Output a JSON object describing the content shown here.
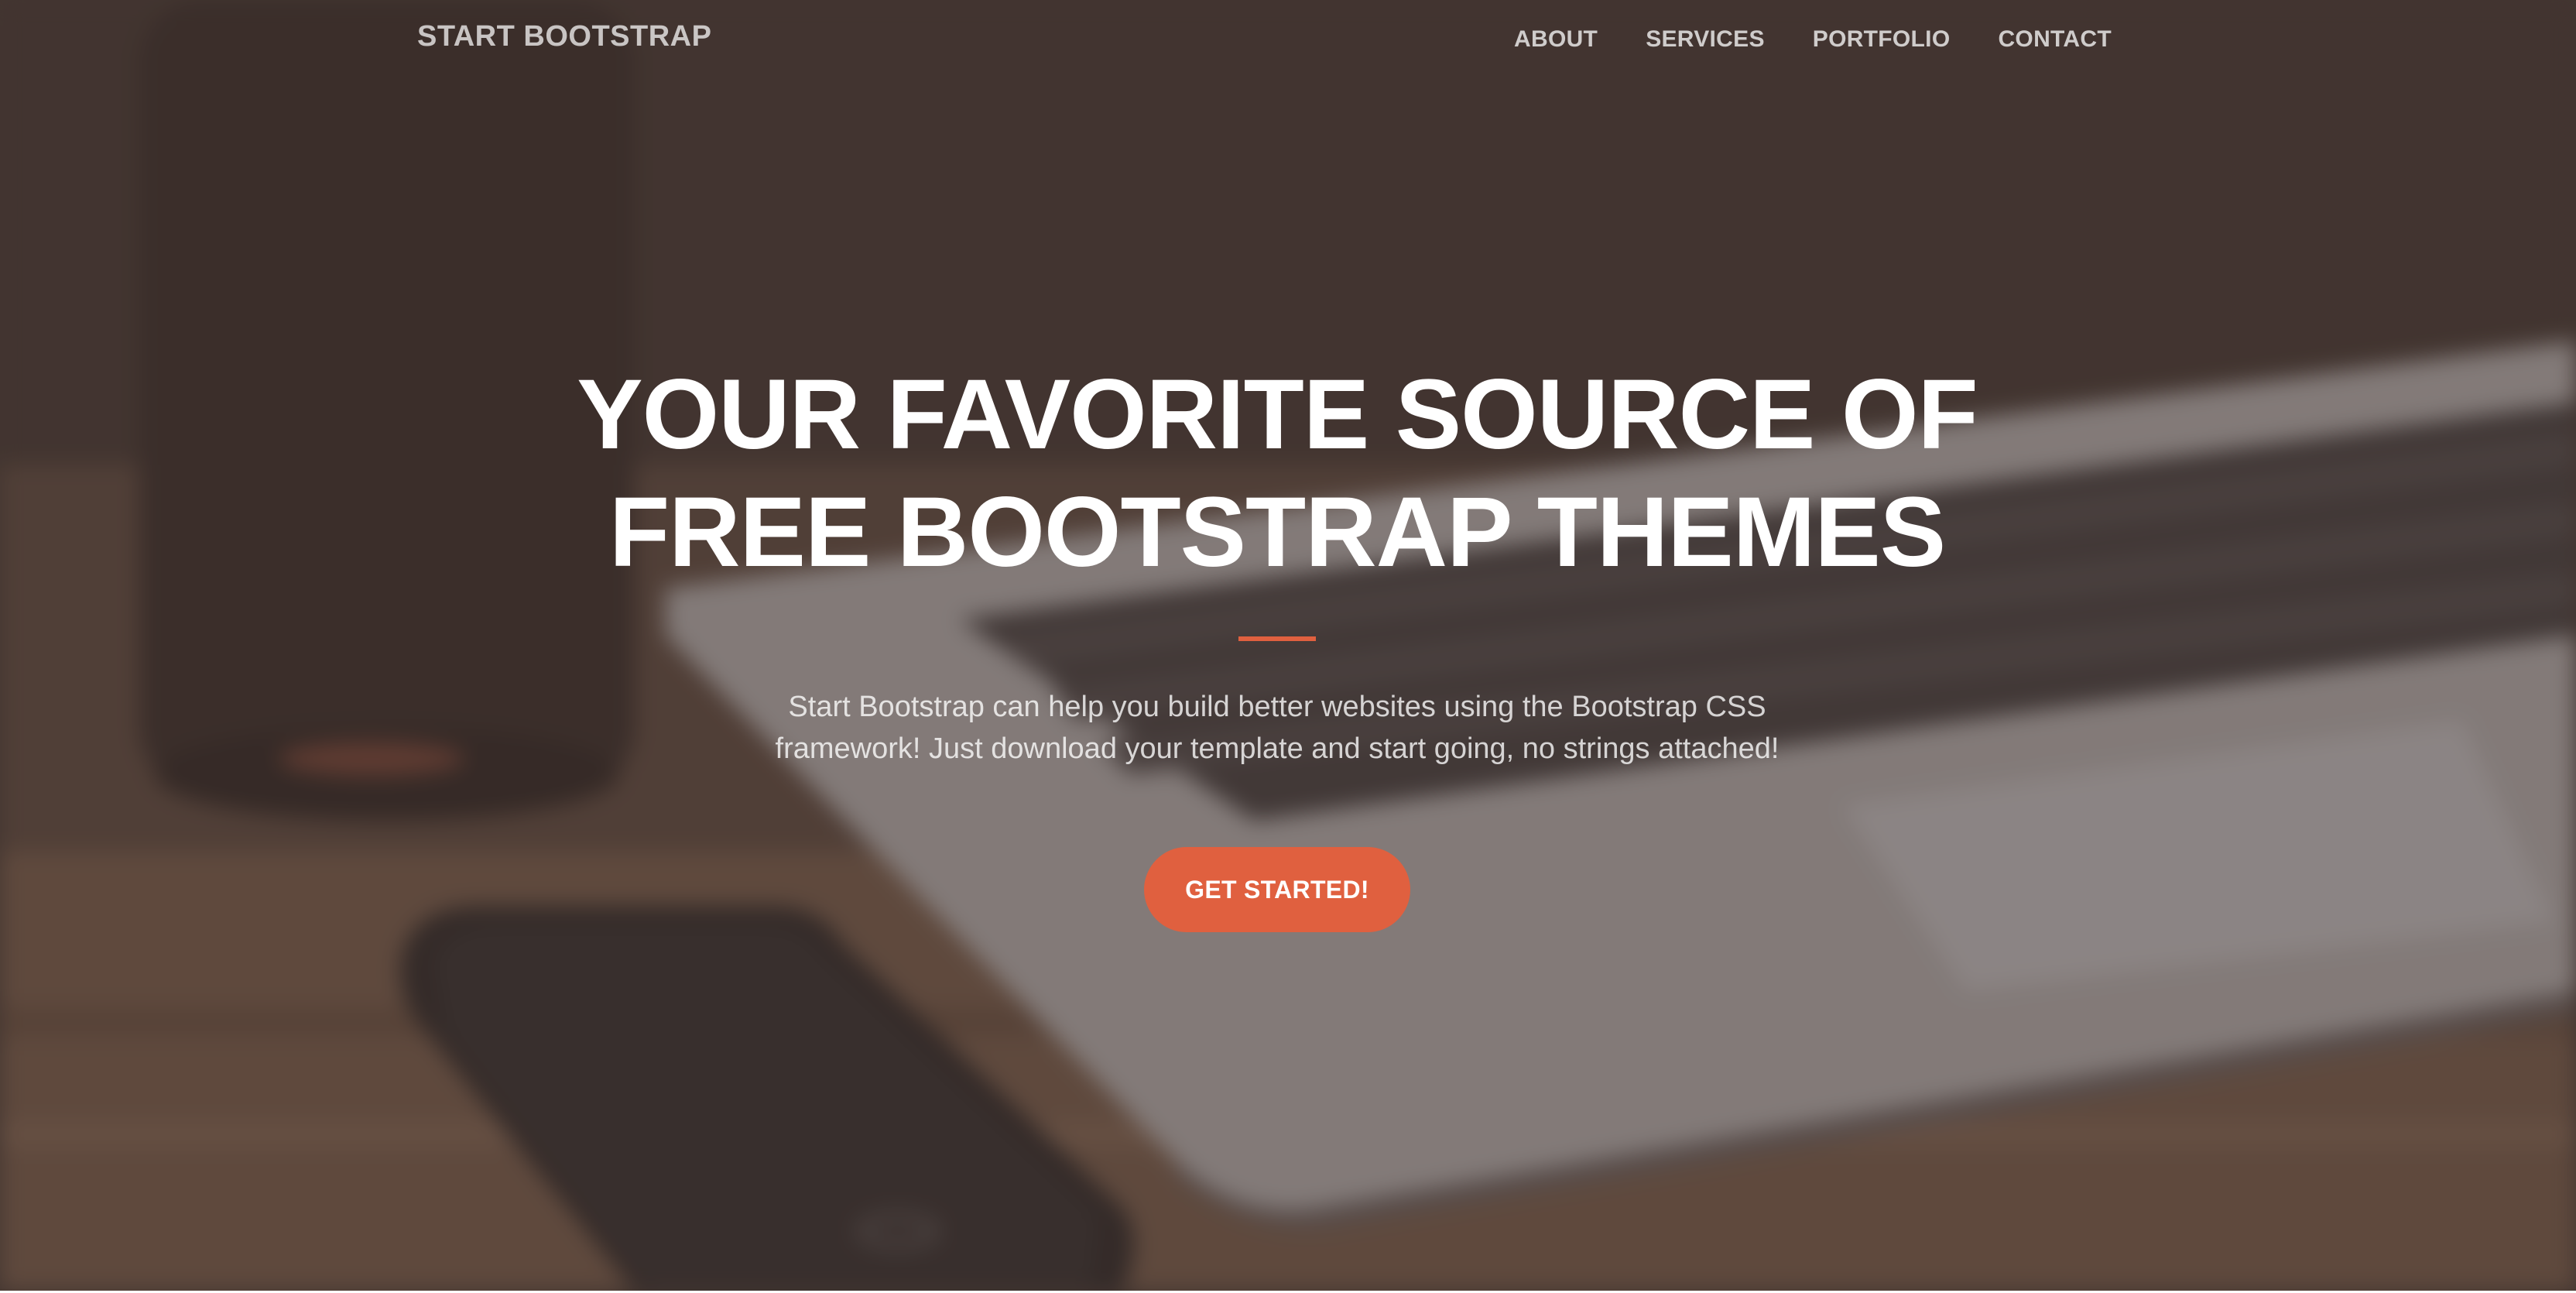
{
  "navbar": {
    "brand": "START BOOTSTRAP",
    "links": [
      {
        "label": "ABOUT"
      },
      {
        "label": "SERVICES"
      },
      {
        "label": "PORTFOLIO"
      },
      {
        "label": "CONTACT"
      }
    ]
  },
  "masthead": {
    "headline": "YOUR FAVORITE SOURCE OF FREE BOOTSTRAP THEMES",
    "lead": "Start Bootstrap can help you build better websites using the Bootstrap CSS framework! Just download your template and start going, no strings attached!",
    "cta_label": "GET STARTED!"
  },
  "colors": {
    "accent": "#e0603f",
    "overlay": "#483c38",
    "text": "#ffffff"
  }
}
